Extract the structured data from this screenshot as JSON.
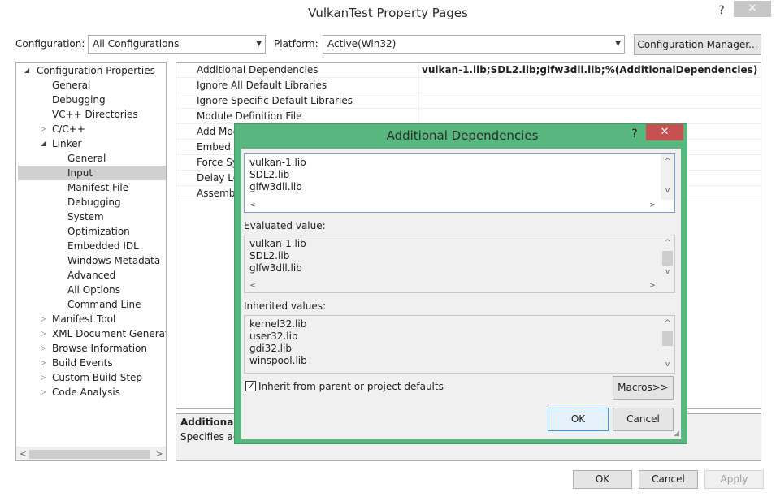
{
  "window": {
    "title": "VulkanTest Property Pages",
    "help_glyph": "?",
    "close_glyph": "✕"
  },
  "toolbar": {
    "configuration_label": "Configuration:",
    "configuration_value": "All Configurations",
    "platform_label": "Platform:",
    "platform_value": "Active(Win32)",
    "config_manager_label": "Configuration Manager..."
  },
  "tree": {
    "items": [
      {
        "label": "Configuration Properties",
        "expander": "◢"
      },
      {
        "label": "General",
        "expander": ""
      },
      {
        "label": "Debugging",
        "expander": ""
      },
      {
        "label": "VC++ Directories",
        "expander": ""
      },
      {
        "label": "C/C++",
        "expander": "▷"
      },
      {
        "label": "Linker",
        "expander": "◢"
      },
      {
        "label": "General",
        "expander": ""
      },
      {
        "label": "Input",
        "expander": ""
      },
      {
        "label": "Manifest File",
        "expander": ""
      },
      {
        "label": "Debugging",
        "expander": ""
      },
      {
        "label": "System",
        "expander": ""
      },
      {
        "label": "Optimization",
        "expander": ""
      },
      {
        "label": "Embedded IDL",
        "expander": ""
      },
      {
        "label": "Windows Metadata",
        "expander": ""
      },
      {
        "label": "Advanced",
        "expander": ""
      },
      {
        "label": "All Options",
        "expander": ""
      },
      {
        "label": "Command Line",
        "expander": ""
      },
      {
        "label": "Manifest Tool",
        "expander": "▷"
      },
      {
        "label": "XML Document Generator",
        "expander": "▷"
      },
      {
        "label": "Browse Information",
        "expander": "▷"
      },
      {
        "label": "Build Events",
        "expander": "▷"
      },
      {
        "label": "Custom Build Step",
        "expander": "▷"
      },
      {
        "label": "Code Analysis",
        "expander": "▷"
      }
    ],
    "scroll_left": "<",
    "scroll_right": ">"
  },
  "grid": {
    "rows": [
      {
        "name": "Additional Dependencies",
        "value": "vulkan-1.lib;SDL2.lib;glfw3dll.lib;%(AdditionalDependencies)"
      },
      {
        "name": "Ignore All Default Libraries",
        "value": ""
      },
      {
        "name": "Ignore Specific Default Libraries",
        "value": ""
      },
      {
        "name": "Module Definition File",
        "value": ""
      },
      {
        "name": "Add Mod",
        "value": ""
      },
      {
        "name": "Embed M",
        "value": ""
      },
      {
        "name": "Force Sy",
        "value": ""
      },
      {
        "name": "Delay Lo",
        "value": ""
      },
      {
        "name": "Assembl",
        "value": ""
      }
    ]
  },
  "description": {
    "title": "Additional D",
    "text": "Specifies add"
  },
  "footer": {
    "ok_label": "OK",
    "cancel_label": "Cancel",
    "apply_label": "Apply"
  },
  "dialog": {
    "title": "Additional Dependencies",
    "help_glyph": "?",
    "close_glyph": "✕",
    "edit_lines": [
      "vulkan-1.lib",
      "SDL2.lib",
      "glfw3dll.lib"
    ],
    "evaluated_label": "Evaluated value:",
    "evaluated_lines": [
      "vulkan-1.lib",
      "SDL2.lib",
      "glfw3dll.lib"
    ],
    "inherited_label": "Inherited values:",
    "inherited_lines": [
      "kernel32.lib",
      "user32.lib",
      "gdi32.lib",
      "winspool.lib"
    ],
    "inherit_checkbox_label": "Inherit from parent or project defaults",
    "inherit_checked": true,
    "macros_label": "Macros>>",
    "ok_label": "OK",
    "cancel_label": "Cancel",
    "scroll_up": "^",
    "scroll_down": "v",
    "scroll_left": "<",
    "scroll_right": ">"
  }
}
